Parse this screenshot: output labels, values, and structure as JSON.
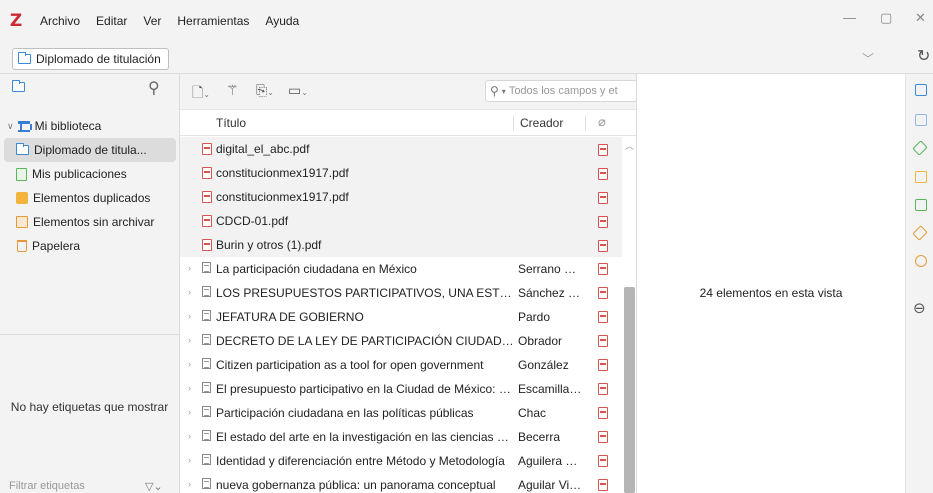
{
  "app": {
    "logo": "Z"
  },
  "menu": [
    "Archivo",
    "Editar",
    "Ver",
    "Herramientas",
    "Ayuda"
  ],
  "window": {
    "minimize": "—",
    "maximize": "▢",
    "close": "✕"
  },
  "library_path": "Diplomado de titulación",
  "collections": [
    {
      "label": "Mi biblioteca",
      "icon": "library-icon",
      "level": 0
    },
    {
      "label": "Diplomado de titula...",
      "icon": "folder-icon",
      "level": 1,
      "selected": true
    },
    {
      "label": "Mis publicaciones",
      "icon": "document-icon",
      "level": 1
    },
    {
      "label": "Elementos duplicados",
      "icon": "duplicates-icon",
      "level": 1
    },
    {
      "label": "Elementos sin archivar",
      "icon": "unfiled-icon",
      "level": 1
    },
    {
      "label": "Papelera",
      "icon": "trash-icon",
      "level": 1
    }
  ],
  "tags": {
    "empty_message": "No hay etiquetas que mostrar",
    "filter_placeholder": "Filtrar etiquetas"
  },
  "search": {
    "placeholder": "Todos los campos y et"
  },
  "columns": {
    "title": "Título",
    "creator": "Creador"
  },
  "items": [
    {
      "title": "digital_el_abc.pdf",
      "creator": "",
      "type": "attachment"
    },
    {
      "title": "constitucionmex1917.pdf",
      "creator": "",
      "type": "attachment"
    },
    {
      "title": "constitucionmex1917.pdf",
      "creator": "",
      "type": "attachment"
    },
    {
      "title": "CDCD-01.pdf",
      "creator": "",
      "type": "attachment"
    },
    {
      "title": "Burin y otros (1).pdf",
      "creator": "",
      "type": "attachment"
    },
    {
      "title": "La participación ciudadana en México",
      "creator": "Serrano Ro...",
      "type": "item"
    },
    {
      "title": "LOS PRESUPUESTOS PARTICIPATIVOS, UNA ESTRATEGIA ...",
      "creator": "Sánchez y ...",
      "type": "item"
    },
    {
      "title": "JEFATURA DE GOBIERNO",
      "creator": "Pardo",
      "type": "item"
    },
    {
      "title": "DECRETO DE LA LEY DE PARTICIPACIÓN CIUDADANA DE...",
      "creator": "Obrador",
      "type": "item"
    },
    {
      "title": "Citizen participation as a tool for open government",
      "creator": "González",
      "type": "item"
    },
    {
      "title": "El presupuesto participativo en la Ciudad de México: mo...",
      "creator": "Escamilla C...",
      "type": "item"
    },
    {
      "title": "Participación ciudadana en las políticas públicas",
      "creator": "Chac",
      "type": "item"
    },
    {
      "title": "El estado del arte en la investigación en las ciencias soci...",
      "creator": "Becerra",
      "type": "item"
    },
    {
      "title": "Identidad y diferenciación entre Método y Metodología",
      "creator": "Aguilera Hi...",
      "type": "item"
    },
    {
      "title": "nueva gobernanza pública: un panorama conceptual",
      "creator": "Aguilar Vill...",
      "type": "item"
    }
  ],
  "item_pane": {
    "count_text": "24 elementos en esta vista"
  }
}
